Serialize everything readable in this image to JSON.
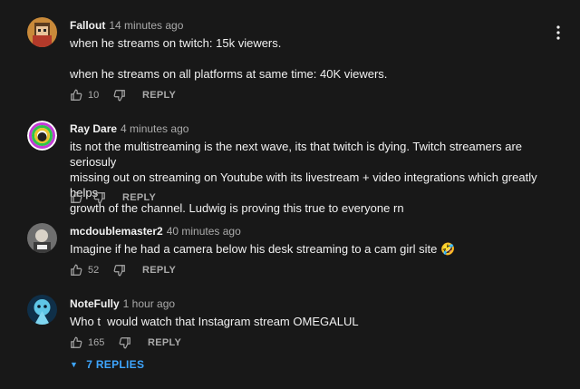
{
  "comments": [
    {
      "author": "Fallout",
      "time": "14 minutes ago",
      "lines": [
        "when he streams on twitch: 15k viewers.",
        "",
        "when he streams on all platforms at same time: 40K viewers."
      ],
      "likes": "10",
      "reply_label": "REPLY"
    },
    {
      "author": "Ray Dare",
      "time": "4 minutes ago",
      "lines": [
        "its not the multistreaming is the next wave, its that twitch is dying. Twitch streamers are seriosuly",
        "missing out on streaming on Youtube with its livestream + video integrations which greatly helps",
        "growth of the channel. Ludwig is proving this true to everyone rn"
      ],
      "likes": "",
      "reply_label": "REPLY"
    },
    {
      "author": "mcdoublemaster2",
      "time": "40 minutes ago",
      "lines": [
        "Imagine if he had a camera below his desk streaming to a cam girl site 🤣"
      ],
      "likes": "52",
      "reply_label": "REPLY"
    },
    {
      "author": "NoteFully",
      "time": "1 hour ago",
      "lines": [
        "Who t  would watch that Instagram stream OMEGALUL"
      ],
      "likes": "165",
      "reply_label": "REPLY"
    }
  ],
  "replies_toggle": {
    "label": "7 REPLIES",
    "icon": "caret-down-icon"
  },
  "colors": {
    "background": "#181818",
    "text": "#f1f1f1",
    "secondary": "#aaaaaa",
    "link": "#3ea6ff"
  },
  "icons": {
    "like": "thumbs-up-icon",
    "dislike": "thumbs-down-icon",
    "menu": "more-vertical-icon"
  }
}
